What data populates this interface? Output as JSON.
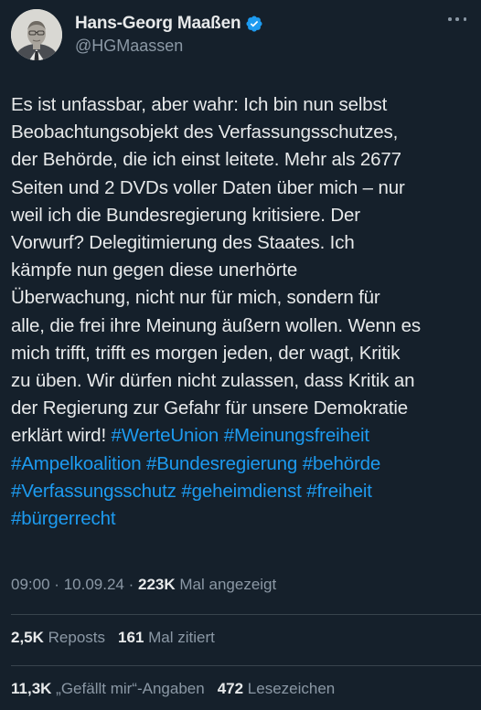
{
  "author": {
    "display_name": "Hans-Georg Maaßen",
    "handle": "@HGMaassen",
    "verified": true,
    "avatar_icon": "avatar-photo"
  },
  "more_icon": "more-horizontal-icon",
  "tweet": {
    "lines": [
      {
        "text": "Es ist unfassbar, aber wahr: Ich bin nun selbst"
      },
      {
        "text": "Beobachtungsobjekt des Verfassungsschutzes,"
      },
      {
        "text": "der Behörde, die ich einst leitete. Mehr als 2677"
      },
      {
        "text": "Seiten und 2 DVDs voller Daten über mich – nur"
      },
      {
        "text": "weil ich die Bundesregierung kritisiere. Der"
      },
      {
        "text": "Vorwurf? Delegitimierung des Staates. Ich"
      },
      {
        "text": "kämpfe nun gegen diese unerhörte"
      },
      {
        "text": "Überwachung, nicht nur für mich, sondern für"
      },
      {
        "text": "alle, die frei ihre Meinung äußern wollen. Wenn es"
      },
      {
        "text": "mich trifft, trifft es morgen jeden, der wagt, Kritik"
      },
      {
        "text": "zu üben. Wir dürfen nicht zulassen, dass Kritik an"
      },
      {
        "text": "der Regierung zur Gefahr für unsere Demokratie"
      },
      {
        "text": "erklärt wird! ",
        "tags": [
          "#WerteUnion",
          "#Meinungsfreiheit"
        ]
      },
      {
        "text": "",
        "tags": [
          "#Ampelkoalition",
          "#Bundesregierung",
          "#behörde"
        ]
      },
      {
        "text": "",
        "tags": [
          "#Verfassungsschutz",
          "#geheimdienst",
          "#freiheit"
        ]
      },
      {
        "text": "",
        "tags": [
          "#bürgerrecht"
        ]
      }
    ]
  },
  "meta": {
    "time": "09:00",
    "separator": "·",
    "date": "10.09.24",
    "views_count": "223K",
    "views_label": "Mal angezeigt"
  },
  "stats": {
    "reposts_count": "2,5K",
    "reposts_label": "Reposts",
    "quotes_count": "161",
    "quotes_label": "Mal zitiert",
    "likes_count": "11,3K",
    "likes_label": "„Gefällt mir“-Angaben",
    "bookmarks_count": "472",
    "bookmarks_label": "Lesezeichen"
  },
  "colors": {
    "background": "#15202b",
    "text": "#e7e9ea",
    "secondary": "#8b98a5",
    "link": "#1d9bf0",
    "divider": "#38444d"
  }
}
